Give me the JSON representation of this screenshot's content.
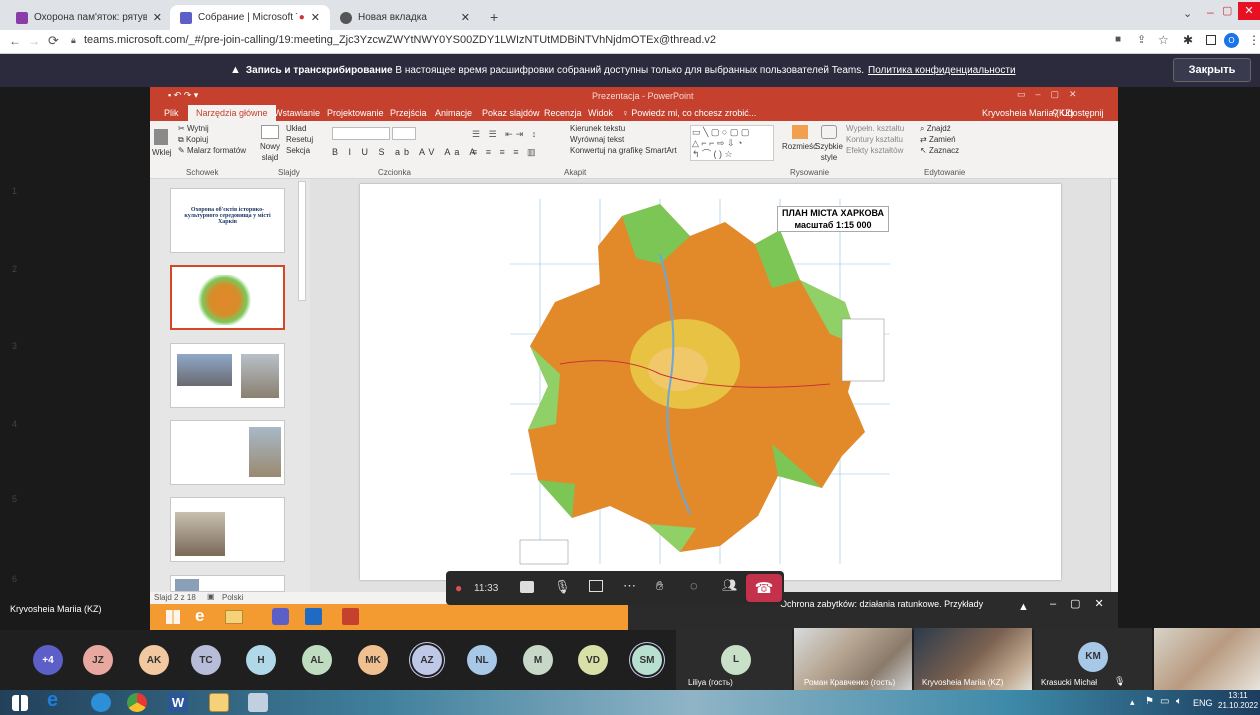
{
  "browser": {
    "tabs": [
      {
        "label": "Охорона пам'яток: рятувальні з",
        "color": "#8a3da8"
      },
      {
        "label": "Собрание | Microsoft Teams",
        "color": "#5b5fc7"
      },
      {
        "label": "Новая вкладка",
        "color": "#4a4a4a"
      }
    ],
    "url": "teams.microsoft.com/_#/pre-join-calling/19:meeting_Zjc3YzcwZWYtNWY0YS00ZDY1LWIzNTUtMDBiNTVhNjdmOTEx@thread.v2"
  },
  "banner": {
    "bold": "Запись и транскрибирование",
    "text": " В настоящее время расшифровки собраний доступны только для выбранных пользователей Teams.",
    "link": "Политика конфиденциальности",
    "close": "Закрыть"
  },
  "ppt": {
    "title": "Prezentacja - PowerPoint",
    "user": "Kryvosheia Mariia (KZ)",
    "share": "Udostępnij",
    "tabs": [
      "Plik",
      "Narzędzia główne",
      "Wstawianie",
      "Projektowanie",
      "Przejścia",
      "Animacje",
      "Pokaz slajdów",
      "Recenzja",
      "Widok"
    ],
    "tellme": "Powiedz mi, co chcesz zrobić...",
    "groups": {
      "schowek": {
        "items": [
          "Wytnij",
          "Kopiuj",
          "Malarz formatów"
        ],
        "paste": "Wklej",
        "label": "Schowek"
      },
      "slajdy": {
        "items": [
          "Układ",
          "Resetuj",
          "Sekcja"
        ],
        "new": "Nowy slajd",
        "label": "Slajdy"
      },
      "czcionka": {
        "label": "Czcionka"
      },
      "akapit": {
        "items": [
          "Kierunek tekstu",
          "Wyrównaj tekst",
          "Konwertuj na grafikę SmartArt"
        ],
        "label": "Akapit"
      },
      "rysowanie": {
        "arrange": "Rozmieść",
        "styles": "Szybkie style",
        "items": [
          "Wypełn. kształtu",
          "Kontury kształtu",
          "Efekty kształtów"
        ],
        "label": "Rysowanie"
      },
      "edytowanie": {
        "items": [
          "Znajdź",
          "Zamień",
          "Zaznacz"
        ],
        "label": "Edytowanie"
      }
    },
    "thumbs": [
      {
        "num": "1",
        "text": "Охорона об'єктів історико-культурного середовища у місті Харків"
      },
      {
        "num": "2",
        "text": ""
      },
      {
        "num": "3",
        "text": ""
      },
      {
        "num": "4",
        "text": ""
      },
      {
        "num": "5",
        "text": ""
      },
      {
        "num": "6",
        "text": ""
      }
    ],
    "status": {
      "slide": "Slajd 2 z 18",
      "lang": "Polski"
    },
    "map_title_1": "ПЛАН МІСТА ХАРКОВА",
    "map_title_2": "масштаб 1:15 000"
  },
  "meeting": {
    "time": "11:33",
    "presenter": "Kryvosheia Mariia (KZ)",
    "notification": "Ochrona zabytków: działania ratunkowe. Przykłady"
  },
  "participants": [
    {
      "initials": "+4",
      "color": "#5b5fc7",
      "text_color": "#ffffff"
    },
    {
      "initials": "JZ",
      "color": "#e8a8a0"
    },
    {
      "initials": "AK",
      "color": "#f2c8a0"
    },
    {
      "initials": "TC",
      "color": "#b7bcd8"
    },
    {
      "initials": "H",
      "color": "#b0d8e8"
    },
    {
      "initials": "AL",
      "color": "#c0dcc0"
    },
    {
      "initials": "MK",
      "color": "#f0c090"
    },
    {
      "initials": "AZ",
      "color": "#c0c8e8"
    },
    {
      "initials": "NL",
      "color": "#a8c8e8"
    },
    {
      "initials": "M",
      "color": "#c8d8c8"
    },
    {
      "initials": "VD",
      "color": "#d8e0a8"
    },
    {
      "initials": "SM",
      "color": "#b8e0d0"
    }
  ],
  "videos": [
    {
      "name": "Liliya (гость)",
      "initials": "L",
      "color": "#c8e0c8"
    },
    {
      "name": "Роман Кравченко (гость)"
    },
    {
      "name": "Kryvosheia Mariia (KZ)"
    },
    {
      "name": "Krasucki Michał",
      "initials": "KM",
      "color": "#a8c8e8"
    },
    {
      "name": ""
    }
  ],
  "tray": {
    "lang": "ENG",
    "time": "13:11",
    "date": "21.10.2022"
  }
}
